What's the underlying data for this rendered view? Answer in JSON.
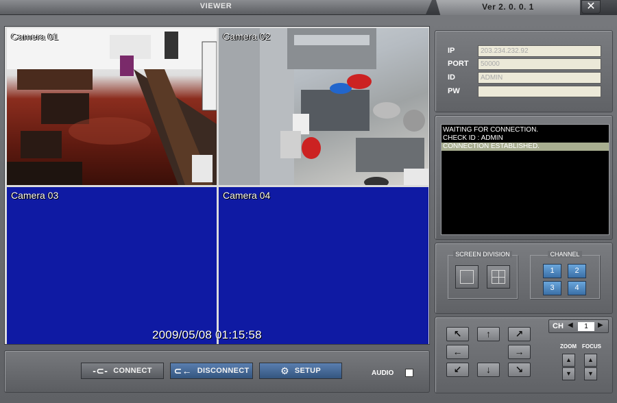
{
  "window": {
    "title": "VIEWER",
    "version": "Ver 2. 0. 0. 1",
    "close_glyph": "✕"
  },
  "cameras": [
    {
      "label": "Camera 01"
    },
    {
      "label": "Camera 02"
    },
    {
      "label": "Camera 03"
    },
    {
      "label": "Camera 04"
    }
  ],
  "timestamp": "2009/05/08 01:15:58",
  "controls": {
    "connect": "CONNECT",
    "disconnect": "DISCONNECT",
    "setup": "SETUP",
    "audio": "AUDIO"
  },
  "login": {
    "ip_label": "IP",
    "ip_value": "203.234.232.92",
    "port_label": "PORT",
    "port_value": "50000",
    "id_label": "ID",
    "id_value": "ADMIN",
    "pw_label": "PW",
    "pw_value": ""
  },
  "log": [
    "WAITING FOR CONNECTION.",
    "CHECK ID : ADMIN",
    "CONNECTION ESTABLISHED."
  ],
  "screen_division": {
    "title": "SCREEN DIVISION"
  },
  "channel": {
    "title": "CHANNEL",
    "buttons": [
      "1",
      "2",
      "3",
      "4"
    ]
  },
  "ptz": {
    "ch_label": "CH",
    "ch_value": "1",
    "zoom_label": "ZOOM",
    "focus_label": "FOCUS"
  },
  "colors": {
    "empty_channel": "#0f1aa3",
    "channel_button": "#3a6fa6",
    "log_highlight": "#a8ae90"
  }
}
